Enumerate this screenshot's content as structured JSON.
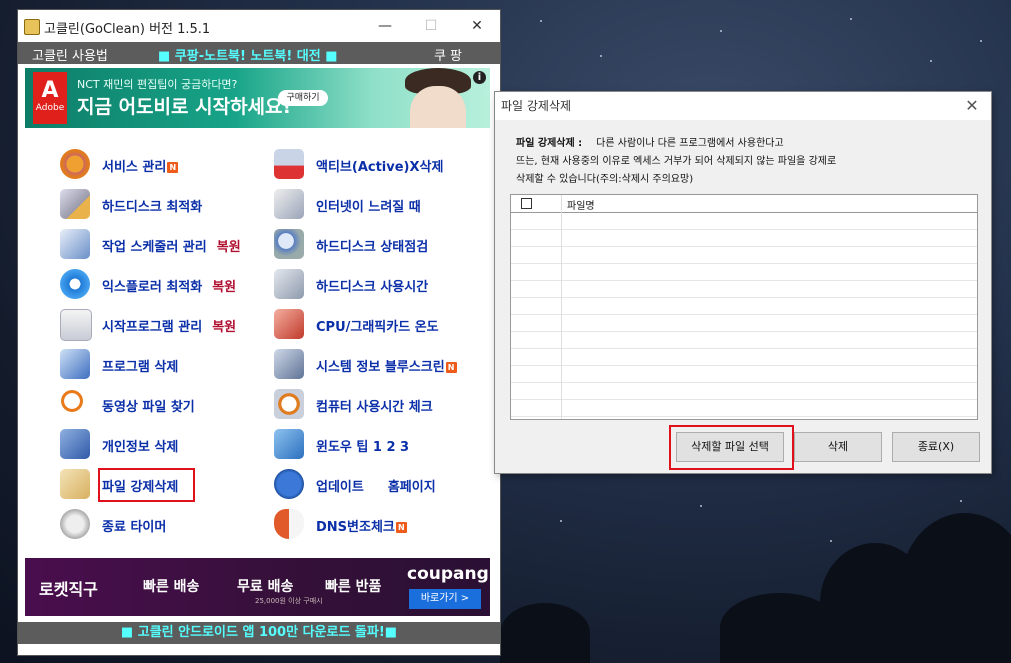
{
  "main_window": {
    "title": "고클린(GoClean) 버전 1.5.1",
    "menubar": {
      "left": "고클린 사용법",
      "center": "■ 쿠팡-노트북! 노트북! 대전 ■",
      "right": "쿠 팡"
    },
    "ad_top": {
      "brand": "Adobe",
      "line1": "NCT 재민의 편집팁이 궁금하다면?",
      "line2": "지금 어도비로 시작하세요!",
      "button": "구매하기"
    },
    "left_items": [
      {
        "label": "서비스 관리",
        "badge": "N",
        "extra": ""
      },
      {
        "label": "하드디스크 최적화",
        "badge": "",
        "extra": ""
      },
      {
        "label": "작업 스케줄러 관리",
        "badge": "",
        "extra": "복원"
      },
      {
        "label": "익스플로러 최적화",
        "badge": "",
        "extra": "복원"
      },
      {
        "label": "시작프로그램 관리",
        "badge": "",
        "extra": "복원"
      },
      {
        "label": "프로그램 삭제",
        "badge": "",
        "extra": ""
      },
      {
        "label": "동영상 파일 찾기",
        "badge": "",
        "extra": ""
      },
      {
        "label": "개인정보 삭제",
        "badge": "",
        "extra": ""
      },
      {
        "label": "파일 강제삭제",
        "badge": "",
        "extra": ""
      },
      {
        "label": "종료 타이머",
        "badge": "",
        "extra": ""
      }
    ],
    "right_items": [
      {
        "label": "액티브(Active)X삭제",
        "badge": "",
        "extra": ""
      },
      {
        "label": "인터넷이 느려질 때",
        "badge": "",
        "extra": ""
      },
      {
        "label": "하드디스크 상태점검",
        "badge": "",
        "extra": ""
      },
      {
        "label": "하드디스크 사용시간",
        "badge": "",
        "extra": ""
      },
      {
        "label": "CPU/그래픽카드 온도",
        "badge": "",
        "extra": ""
      },
      {
        "label": "시스템 정보 블루스크린",
        "badge": "N",
        "extra": ""
      },
      {
        "label": "컴퓨터 사용시간 체크",
        "badge": "",
        "extra": ""
      },
      {
        "label": "윈도우 팁 1   2   3",
        "badge": "",
        "extra": ""
      },
      {
        "label": "업데이트",
        "badge": "",
        "extra": "홈페이지"
      },
      {
        "label": "DNS변조체크",
        "badge": "N",
        "extra": ""
      }
    ],
    "ad_bottom": {
      "t1": "로켓직구",
      "t2": "빠른 배송",
      "t3": "무료 배송",
      "t4": "빠른 반품",
      "sub": "25,000원 이상 구매시",
      "brand": "coupang",
      "button": "바로가기 >"
    },
    "bottombar": "■ 고클린 안드로이드 앱 100만 다운로드 돌파!■"
  },
  "dialog": {
    "title": "파일 강제삭제",
    "close": "✕",
    "desc_label": "파일 강제삭제 :",
    "desc1": "다른 사람이나 다른 프로그램에서 사용한다고",
    "desc2": "뜨는, 현재 사용중의 이유로 엑세스 거부가 되어 삭제되지 않는 파일을 강제로",
    "desc3": "삭제할 수 있습니다(주의:삭제시 주의요망)",
    "column": "파일명",
    "btn_select": "삭제할 파일 선택",
    "btn_delete": "삭제",
    "btn_exit": "종료(X)"
  },
  "colors": {
    "accent_blue": "#0a2fa8",
    "restore_red": "#b01030",
    "highlight": "#e0101c"
  }
}
